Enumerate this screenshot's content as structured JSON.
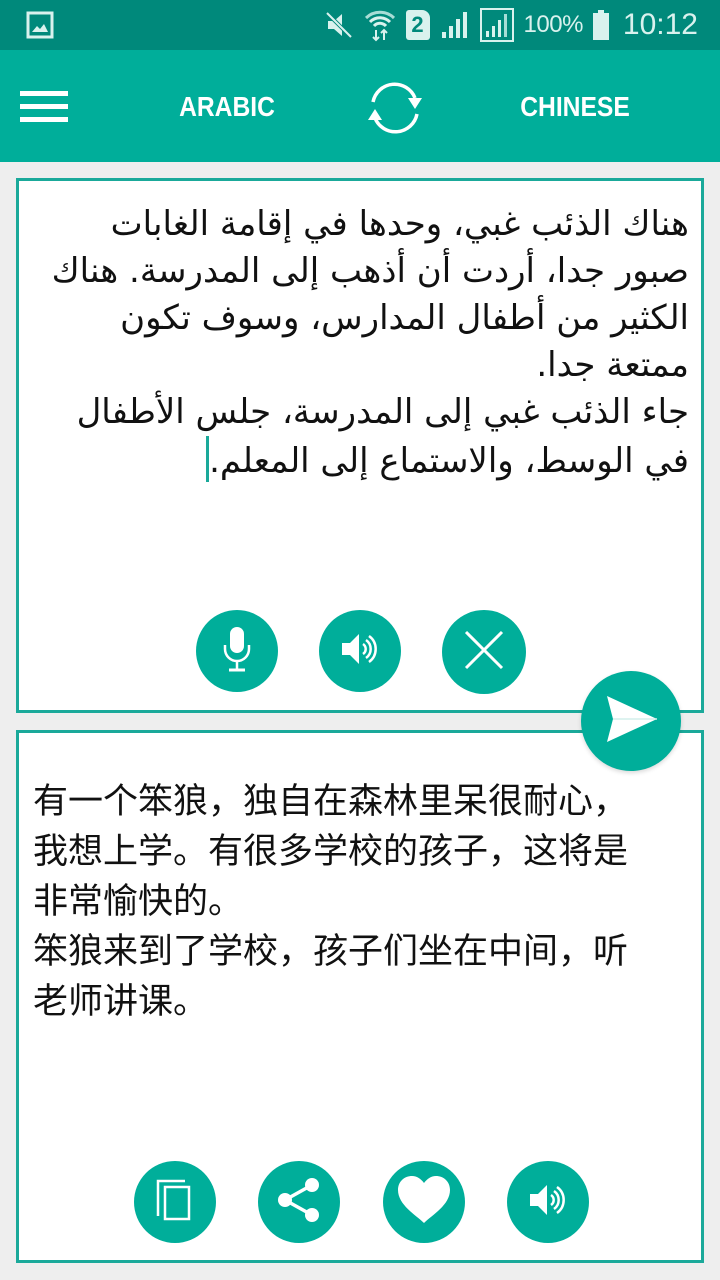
{
  "status_bar": {
    "left_icon": "gallery-notification-icon",
    "icons": [
      "mute-icon",
      "wifi-data-icon",
      "sim-2-icon",
      "signal-icon",
      "signal-sim2-icon",
      "battery-icon"
    ],
    "sim_label": "2",
    "battery": "100%",
    "time": "10:12"
  },
  "toolbar": {
    "menu_icon": "hamburger-menu-icon",
    "source_language": "ARABIC",
    "swap_icon": "swap-languages-icon",
    "target_language": "CHINESE"
  },
  "input_panel": {
    "paragraphs": [
      "هناك الذئب غبي، وحدها في إقامة الغابات صبور جدا، أردت أن أذهب إلى المدرسة. هناك الكثير من أطفال المدارس، وسوف تكون ممتعة جدا.",
      "جاء الذئب غبي إلى المدرسة، جلس الأطفال في الوسط، والاستماع إلى المعلم."
    ],
    "buttons": [
      {
        "name": "microphone",
        "icon": "microphone-icon"
      },
      {
        "name": "speak-source",
        "icon": "speaker-icon"
      },
      {
        "name": "clear",
        "icon": "close-icon"
      }
    ]
  },
  "translate_button": {
    "icon": "send-icon"
  },
  "output_panel": {
    "paragraphs": [
      "有一个笨狼，独自在森林里呆很耐心，我想上学。有很多学校的孩子，这将是非常愉快的。",
      "笨狼来到了学校，孩子们坐在中间，听老师讲课。"
    ],
    "buttons": [
      {
        "name": "copy",
        "icon": "copy-icon"
      },
      {
        "name": "share",
        "icon": "share-icon"
      },
      {
        "name": "favorite",
        "icon": "heart-icon"
      },
      {
        "name": "speak-target",
        "icon": "speaker-icon"
      }
    ]
  },
  "colors": {
    "status_bar": "#00897b",
    "primary": "#00ae9a",
    "card_border": "#1aa99a",
    "background": "#eeeeee"
  }
}
